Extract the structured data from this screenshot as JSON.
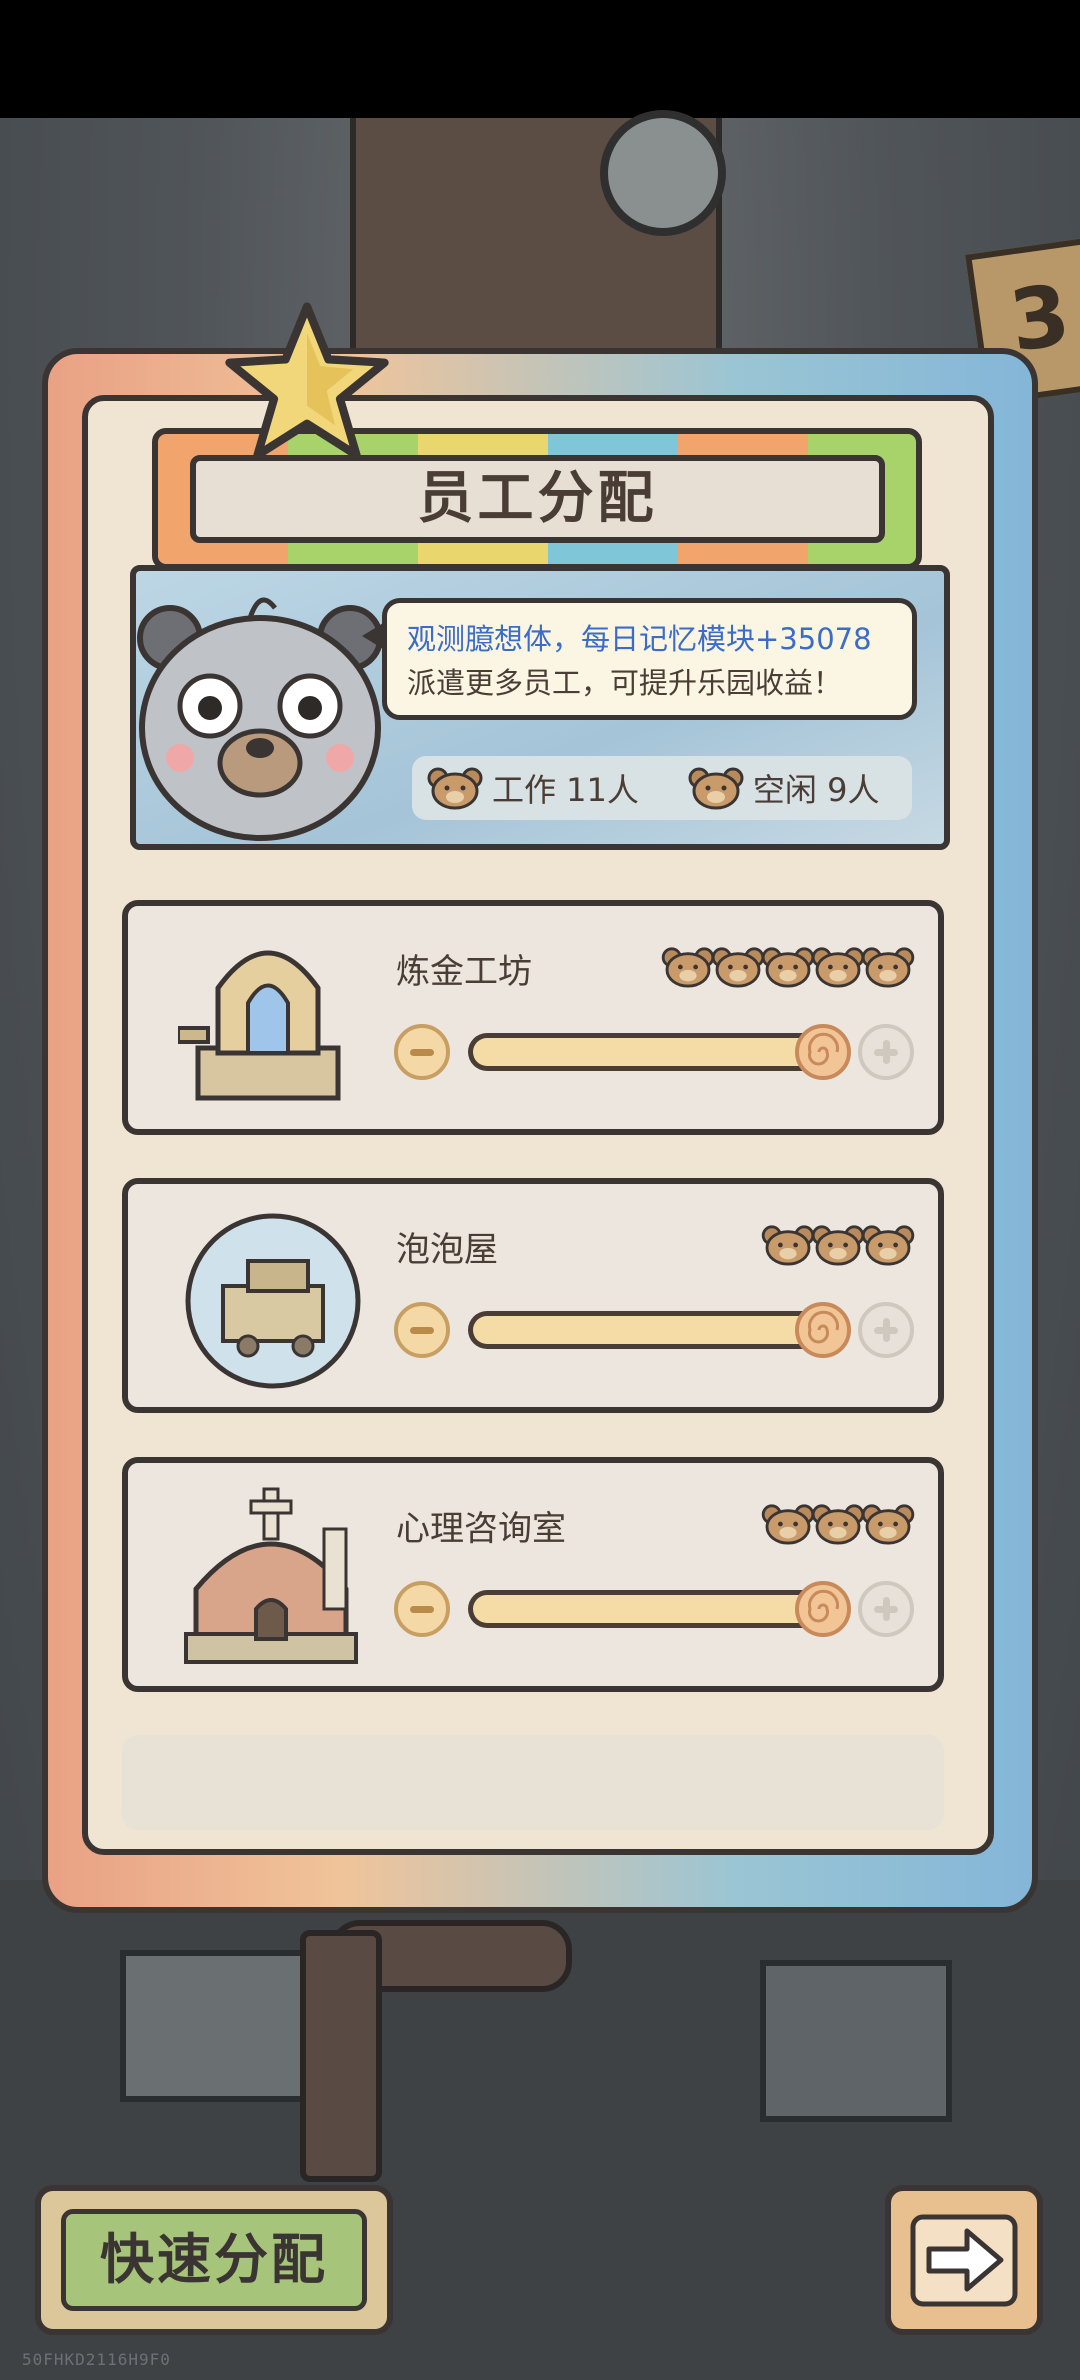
{
  "dialog": {
    "title": "员工分配",
    "message_line1": "观测臆想体，每日记忆模块+35078",
    "message_line2": "派遣更多员工，可提升乐园收益！",
    "working_label": "工作 11人",
    "idle_label": "空闲 9人"
  },
  "buildings": [
    {
      "name": "炼金工坊",
      "workers": 5,
      "allocation": 1.0
    },
    {
      "name": "泡泡屋",
      "workers": 3,
      "allocation": 1.0
    },
    {
      "name": "心理咨询室",
      "workers": 3,
      "allocation": 1.0
    }
  ],
  "footer": {
    "quick_assign_label": "快速分配",
    "watermark": "50FHKD2116H9F0"
  },
  "colors": {
    "panel_bg": "#efe5d2",
    "outline": "#3a3533",
    "message_highlight": "#3a6cc8",
    "quick_button": "#a6c47a"
  },
  "icons": [
    "star-icon",
    "panda-mascot-icon",
    "bear-head-icon",
    "minus-icon",
    "plus-icon",
    "snail-knob-icon",
    "arrow-right-icon"
  ]
}
